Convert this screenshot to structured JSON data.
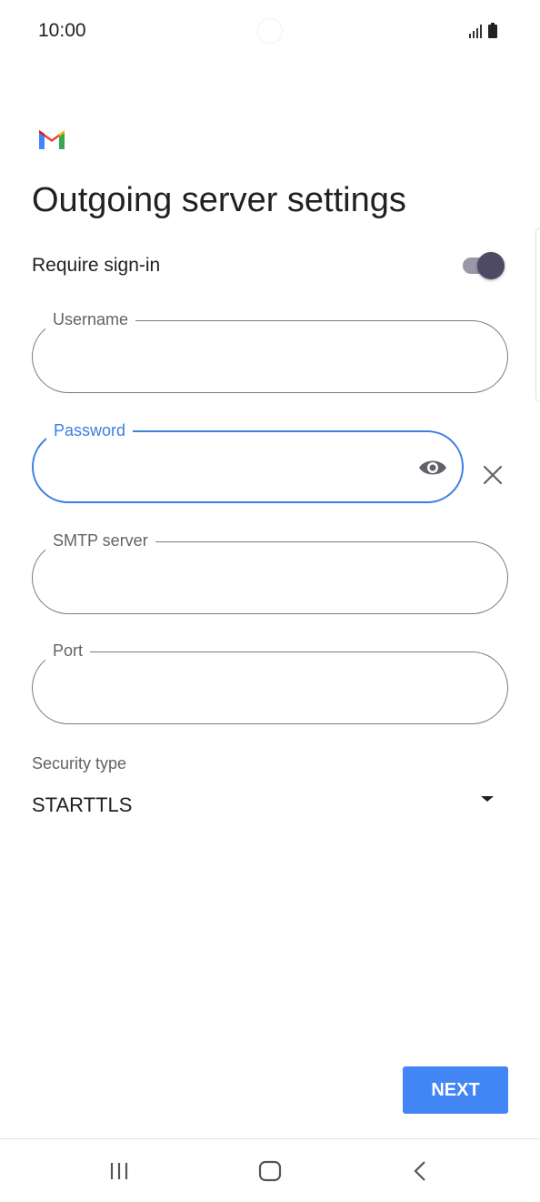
{
  "status_bar": {
    "time": "10:00"
  },
  "header": {
    "title": "Outgoing server settings"
  },
  "require_signin": {
    "label": "Require sign-in",
    "enabled": true
  },
  "fields": {
    "username": {
      "label": "Username",
      "value": ""
    },
    "password": {
      "label": "Password",
      "value": ""
    },
    "smtp": {
      "label": "SMTP server",
      "value": ""
    },
    "port": {
      "label": "Port",
      "value": ""
    }
  },
  "security": {
    "label": "Security type",
    "value": "STARTTLS"
  },
  "actions": {
    "next_label": "NEXT"
  },
  "colors": {
    "accent": "#4285f4",
    "focus": "#3b7fe0",
    "toggle_knob": "#4e4a63"
  }
}
